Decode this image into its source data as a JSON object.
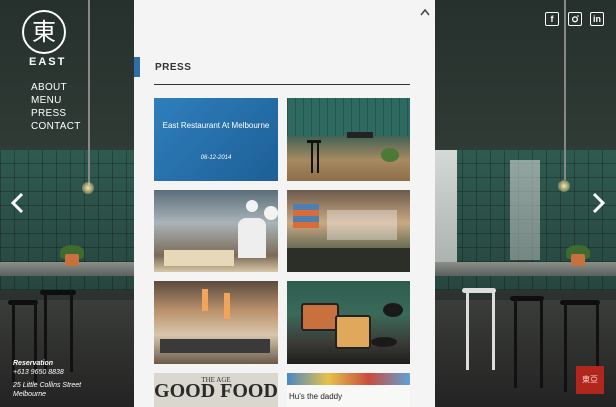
{
  "brand": {
    "logo_glyph": "東",
    "name": "EAST"
  },
  "nav": {
    "items": [
      "ABOUT",
      "MENU",
      "PRESS",
      "CONTACT"
    ]
  },
  "reservation": {
    "heading": "Reservation",
    "phone": "+613 9650 8838",
    "address_line1": "25 Little Collins Street",
    "address_line2": "Melbourne"
  },
  "social": {
    "facebook": "f",
    "instagram": "instagram-icon",
    "linkedin": "in"
  },
  "stamp": {
    "text": "東亞"
  },
  "press": {
    "title": "PRESS",
    "tiles": [
      {
        "headline": "East Restaurant At Melbourne",
        "date": "06-12-2014"
      },
      {
        "headline": ""
      },
      {
        "headline": ""
      },
      {
        "headline": ""
      },
      {
        "headline": ""
      },
      {
        "headline": ""
      },
      {
        "pretitle": "THE AGE",
        "headline": "GOOD FOOD"
      },
      {
        "headline": "Hu's the daddy"
      }
    ]
  },
  "colors": {
    "accent": "#2f6fa8",
    "panel_bg": "#f4f4f4",
    "tile_blue": "#2f7fbd"
  }
}
